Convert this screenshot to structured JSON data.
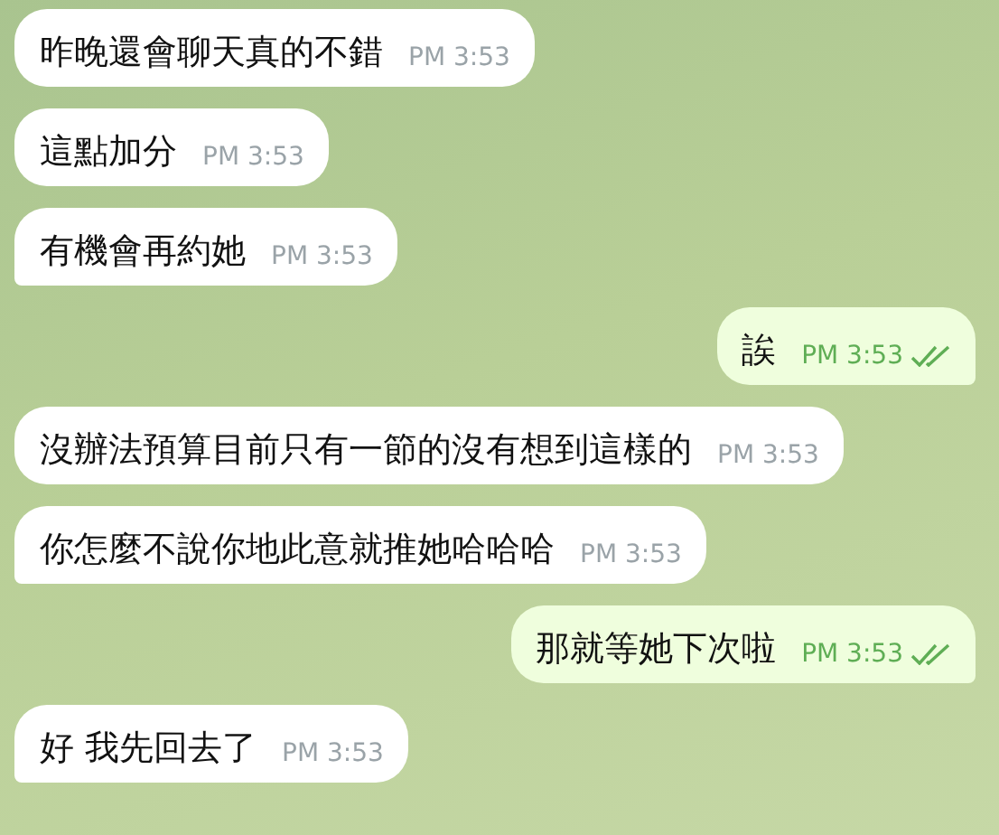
{
  "messages": [
    {
      "kind": "incoming",
      "text": "昨晚還會聊天真的不錯",
      "time": "PM 3:53",
      "tail": false
    },
    {
      "kind": "incoming",
      "text": "這點加分",
      "time": "PM 3:53",
      "tail": false
    },
    {
      "kind": "incoming",
      "text": "有機會再約她",
      "time": "PM 3:53",
      "tail": true
    },
    {
      "kind": "outgoing",
      "text": "誒",
      "time": "PM 3:53",
      "tail": true,
      "read": true
    },
    {
      "kind": "incoming",
      "text": "沒辦法預算目前只有一節的沒有想到這樣的",
      "time": "PM 3:53",
      "tail": false
    },
    {
      "kind": "incoming",
      "text": "你怎麼不說你地此意就推她哈哈哈",
      "time": "PM 3:53",
      "tail": true
    },
    {
      "kind": "outgoing",
      "text": "那就等她下次啦",
      "time": "PM 3:53",
      "tail": true,
      "read": true
    },
    {
      "kind": "incoming",
      "text": "好 我先回去了",
      "time": "PM 3:53",
      "tail": true
    }
  ]
}
